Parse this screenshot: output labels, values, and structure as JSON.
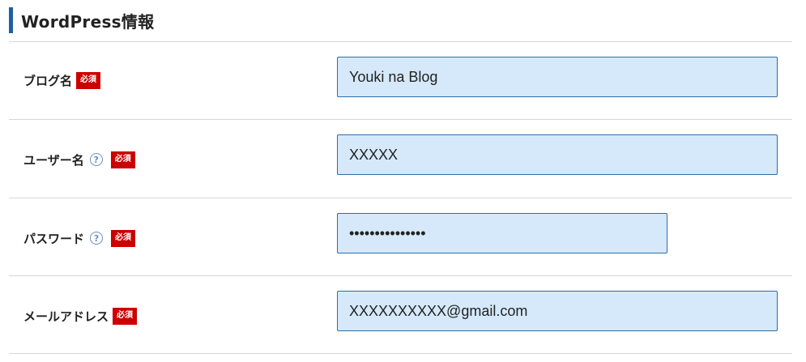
{
  "section": {
    "title": "WordPress情報"
  },
  "badges": {
    "required": "必須",
    "help": "?"
  },
  "fields": {
    "blog_name": {
      "label": "ブログ名",
      "value": "Youki na Blog"
    },
    "username": {
      "label": "ユーザー名",
      "value": "XXXXX"
    },
    "password": {
      "label": "パスワード",
      "value": "•••••••••••••••"
    },
    "email": {
      "label": "メールアドレス",
      "value": "XXXXXXXXXX@gmail.com"
    }
  },
  "colors": {
    "accent_bar": "#1f5f9f",
    "required_badge": "#cc0000",
    "input_background": "#d5e9fb",
    "input_border": "#2e6ca6",
    "divider": "#d6d6d6"
  }
}
